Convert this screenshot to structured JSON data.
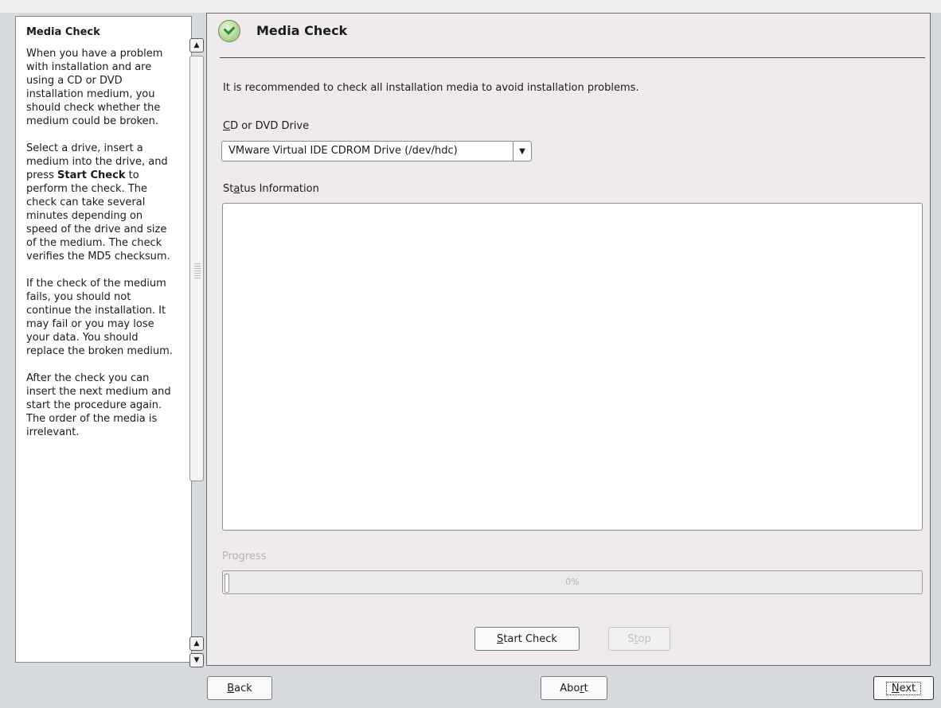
{
  "help": {
    "title": "Media Check",
    "paragraphs": [
      [
        "When you have a problem with installation and are using a CD or DVD installation medium, you should check whether the medium could be broken."
      ],
      [
        "Select a drive, insert a medium into the drive, and press ",
        "Start Check",
        " to perform the check. The check can take several minutes depending on speed of the drive and size of the medium. The check verifies the MD5 checksum."
      ],
      [
        "If the check of the medium fails, you should not continue the installation. It may fail or you may lose your data. You should replace the broken medium."
      ],
      [
        "After the check you can insert the next medium and start the procedure again. The order of the media is irrelevant."
      ]
    ]
  },
  "main": {
    "title": "Media Check",
    "intro": "It is recommended to check all installation media to avoid installation problems.",
    "drive_label": {
      "mnemonic": "C",
      "rest": "D or DVD Drive"
    },
    "drive_value": "VMware Virtual IDE CDROM Drive (/dev/hdc)",
    "status_label": {
      "pre": "St",
      "mnemonic": "a",
      "rest": "tus Information"
    },
    "status_text": "",
    "progress_label": "Progress",
    "progress_value": 0,
    "progress_text": "0%",
    "start_button": {
      "mnemonic": "S",
      "rest": "tart Check"
    },
    "stop_button": {
      "pre": "S",
      "mnemonic": "t",
      "rest": "op"
    }
  },
  "footer": {
    "back": {
      "mnemonic": "B",
      "rest": "ack"
    },
    "abort": {
      "pre": "Abo",
      "mnemonic": "r",
      "rest": "t"
    },
    "next": {
      "mnemonic": "N",
      "rest": "ext"
    }
  },
  "icons": {
    "scroll_up": "triangle-up-icon",
    "scroll_down": "triangle-down-icon",
    "combo": "triangle-down-icon",
    "logo": "suse-check-logo"
  }
}
